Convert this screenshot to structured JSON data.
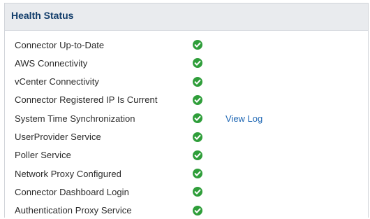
{
  "panel": {
    "title": "Health Status"
  },
  "colors": {
    "ok": "#2f9e3a",
    "link": "#1d66b3",
    "title": "#123d6b"
  },
  "rows": [
    {
      "label": "Connector Up-to-Date",
      "status": "check-circle-icon",
      "link": ""
    },
    {
      "label": "AWS Connectivity",
      "status": "check-circle-icon",
      "link": ""
    },
    {
      "label": "vCenter Connectivity",
      "status": "check-circle-icon",
      "link": ""
    },
    {
      "label": "Connector Registered IP Is Current",
      "status": "check-circle-icon",
      "link": ""
    },
    {
      "label": "System Time Synchronization",
      "status": "check-circle-icon",
      "link": "View Log"
    },
    {
      "label": "UserProvider Service",
      "status": "check-circle-icon",
      "link": ""
    },
    {
      "label": "Poller Service",
      "status": "check-circle-icon",
      "link": ""
    },
    {
      "label": "Network Proxy Configured",
      "status": "check-circle-icon",
      "link": ""
    },
    {
      "label": "Connector Dashboard Login",
      "status": "check-circle-icon",
      "link": ""
    },
    {
      "label": "Authentication Proxy Service",
      "status": "check-circle-icon",
      "link": ""
    }
  ]
}
